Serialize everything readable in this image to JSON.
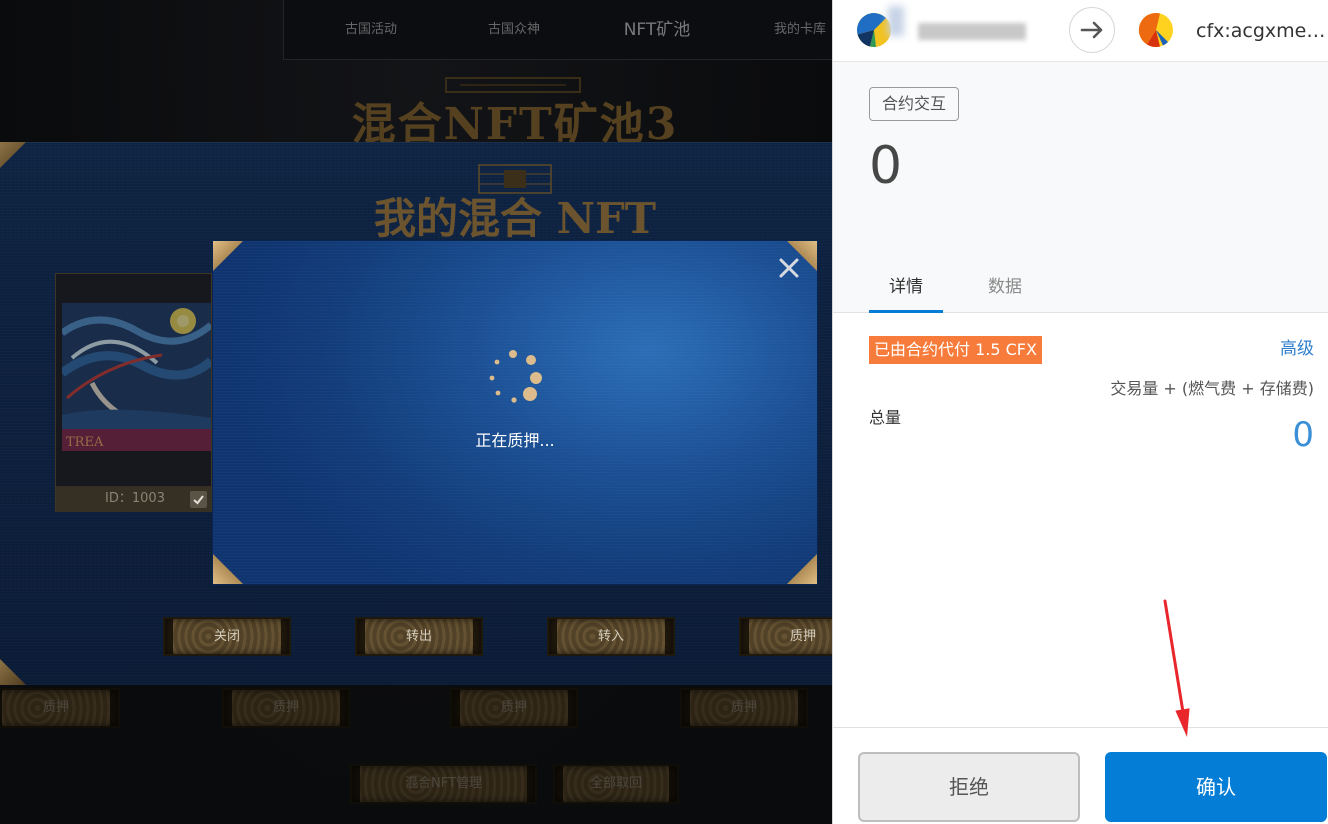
{
  "game": {
    "nav": {
      "tabs": [
        {
          "label": "古国活动"
        },
        {
          "label": "古国众神"
        },
        {
          "label": "NFT矿池"
        },
        {
          "label": "我的卡库"
        }
      ]
    },
    "page_title": "混合NFT矿池3",
    "panel": {
      "title": "我的混合 NFT",
      "card": {
        "art_text": "TREA",
        "id_label": "ID：1003",
        "checked": true,
        "check_icon": "check-icon"
      },
      "buttons": [
        {
          "label": "关闭"
        },
        {
          "label": "转出"
        },
        {
          "label": "转入"
        },
        {
          "label": "质押"
        }
      ]
    },
    "modal": {
      "status_text": "正在质押...",
      "close_icon": "close-icon",
      "spinner_icon": "spinner-icon"
    },
    "stake_buttons": [
      {
        "label": "质押"
      },
      {
        "label": "质押"
      },
      {
        "label": "质押"
      },
      {
        "label": "质押"
      }
    ],
    "footer_buttons": [
      {
        "label": "混合NFT管理"
      },
      {
        "label": "全部取回"
      }
    ]
  },
  "wallet": {
    "header": {
      "from_avatar_icon": "account-avatar-icon",
      "direction_icon": "arrow-right-icon",
      "to_avatar_icon": "contract-avatar-icon",
      "to_address": "cfx:acgxme…"
    },
    "tx_type_badge": "合约交互",
    "amount": "0",
    "tabs": [
      {
        "label": "详情",
        "active": true
      },
      {
        "label": "数据",
        "active": false
      }
    ],
    "sponsor_badge": "已由合约代付 1.5 CFX",
    "advanced_link": "高级",
    "total_formula": "交易量 + (燃气费 + 存储费)",
    "total_label": "总量",
    "total_value": "0",
    "reject_button": "拒绝",
    "confirm_button": "确认"
  },
  "annotation": {
    "icon": "annotation-arrow-icon"
  },
  "colors": {
    "wallet_primary": "#037dd6",
    "sponsor_badge": "#f77b3a",
    "link": "#2f7fcc",
    "total_value": "#3b8fd6",
    "gold": "#c8a060",
    "annotation": "#e8262b"
  }
}
